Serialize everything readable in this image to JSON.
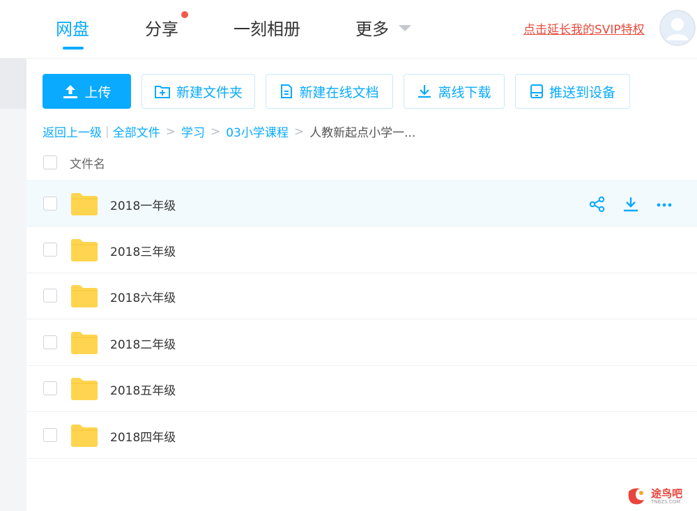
{
  "nav": {
    "items": [
      {
        "label": "网盘",
        "active": true
      },
      {
        "label": "分享",
        "active": false
      },
      {
        "label": "一刻相册",
        "active": false
      },
      {
        "label": "更多",
        "active": false
      }
    ],
    "svip_link": "点击延长我的SVIP特权"
  },
  "toolbar": {
    "upload": "上传",
    "new_folder": "新建文件夹",
    "new_doc": "新建在线文档",
    "offline_download": "离线下载",
    "push_device": "推送到设备"
  },
  "breadcrumb": {
    "back": "返回上一级",
    "bar": "|",
    "items": [
      "全部文件",
      "学习",
      "03小学课程"
    ],
    "current": "人教新起点小学一...",
    "sep": ">"
  },
  "file_list": {
    "column_name": "文件名",
    "rows": [
      {
        "name": "2018一年级",
        "hover": true
      },
      {
        "name": "2018三年级",
        "hover": false
      },
      {
        "name": "2018六年级",
        "hover": false
      },
      {
        "name": "2018二年级",
        "hover": false
      },
      {
        "name": "2018五年级",
        "hover": false
      },
      {
        "name": "2018四年级",
        "hover": false
      }
    ]
  },
  "watermark": {
    "text": "途鸟吧",
    "sub": "TNBZS.COM"
  },
  "colors": {
    "accent": "#09aaff",
    "folder": "#ffd44f",
    "red": "#e64b3c"
  }
}
